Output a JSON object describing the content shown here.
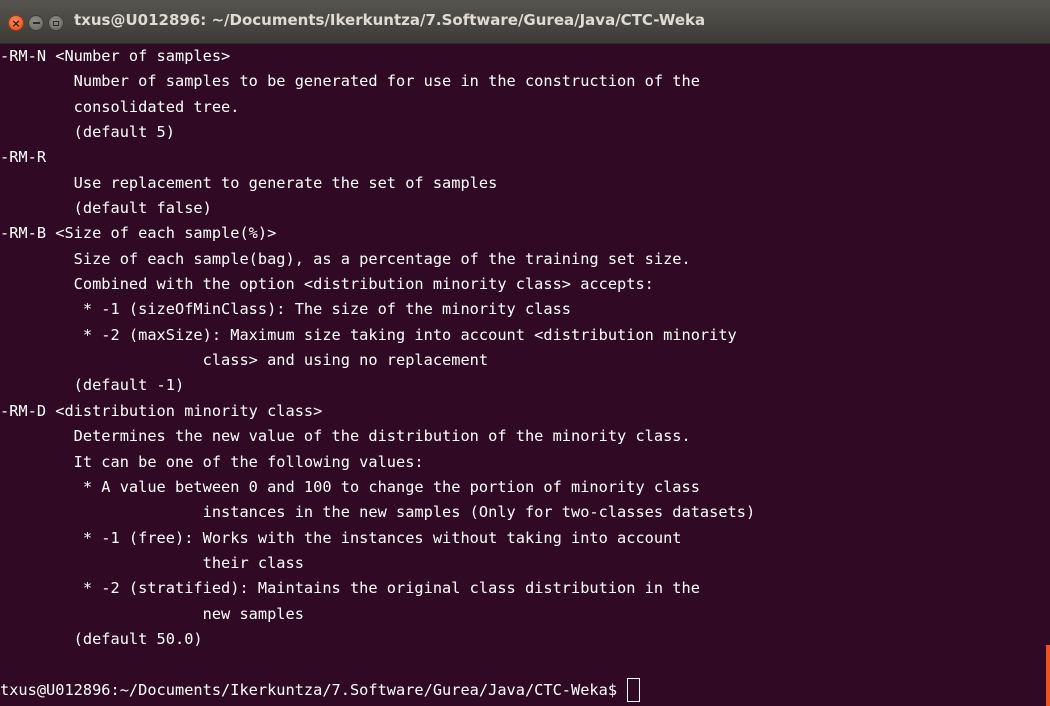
{
  "window": {
    "title": "txus@U012896: ~/Documents/Ikerkuntza/7.Software/Gurea/Java/CTC-Weka",
    "controls": {
      "close_symbol": "×"
    }
  },
  "terminal": {
    "lines": [
      "-RM-N <Number of samples>",
      "        Number of samples to be generated for use in the construction of the",
      "        consolidated tree.",
      "        (default 5)",
      "-RM-R",
      "        Use replacement to generate the set of samples",
      "        (default false)",
      "-RM-B <Size of each sample(%)>",
      "        Size of each sample(bag), as a percentage of the training set size.",
      "        Combined with the option <distribution minority class> accepts:",
      "         * -1 (sizeOfMinClass): The size of the minority class",
      "         * -2 (maxSize): Maximum size taking into account <distribution minority",
      "                      class> and using no replacement",
      "        (default -1)",
      "-RM-D <distribution minority class>",
      "        Determines the new value of the distribution of the minority class.",
      "        It can be one of the following values:",
      "         * A value between 0 and 100 to change the portion of minority class",
      "                      instances in the new samples (Only for two-classes datasets)",
      "         * -1 (free): Works with the instances without taking into account",
      "                      their class",
      "         * -2 (stratified): Maintains the original class distribution in the",
      "                      new samples",
      "        (default 50.0)",
      ""
    ],
    "prompt": "txus@U012896:~/Documents/Ikerkuntza/7.Software/Gurea/Java/CTC-Weka$ "
  },
  "colors": {
    "background": "#300a24",
    "text": "#ffffff",
    "titlebar": "#3c3b37",
    "title_text": "#dfdbd2",
    "close_button": "#df4a16",
    "scrollbar_accent": "#e95420"
  }
}
